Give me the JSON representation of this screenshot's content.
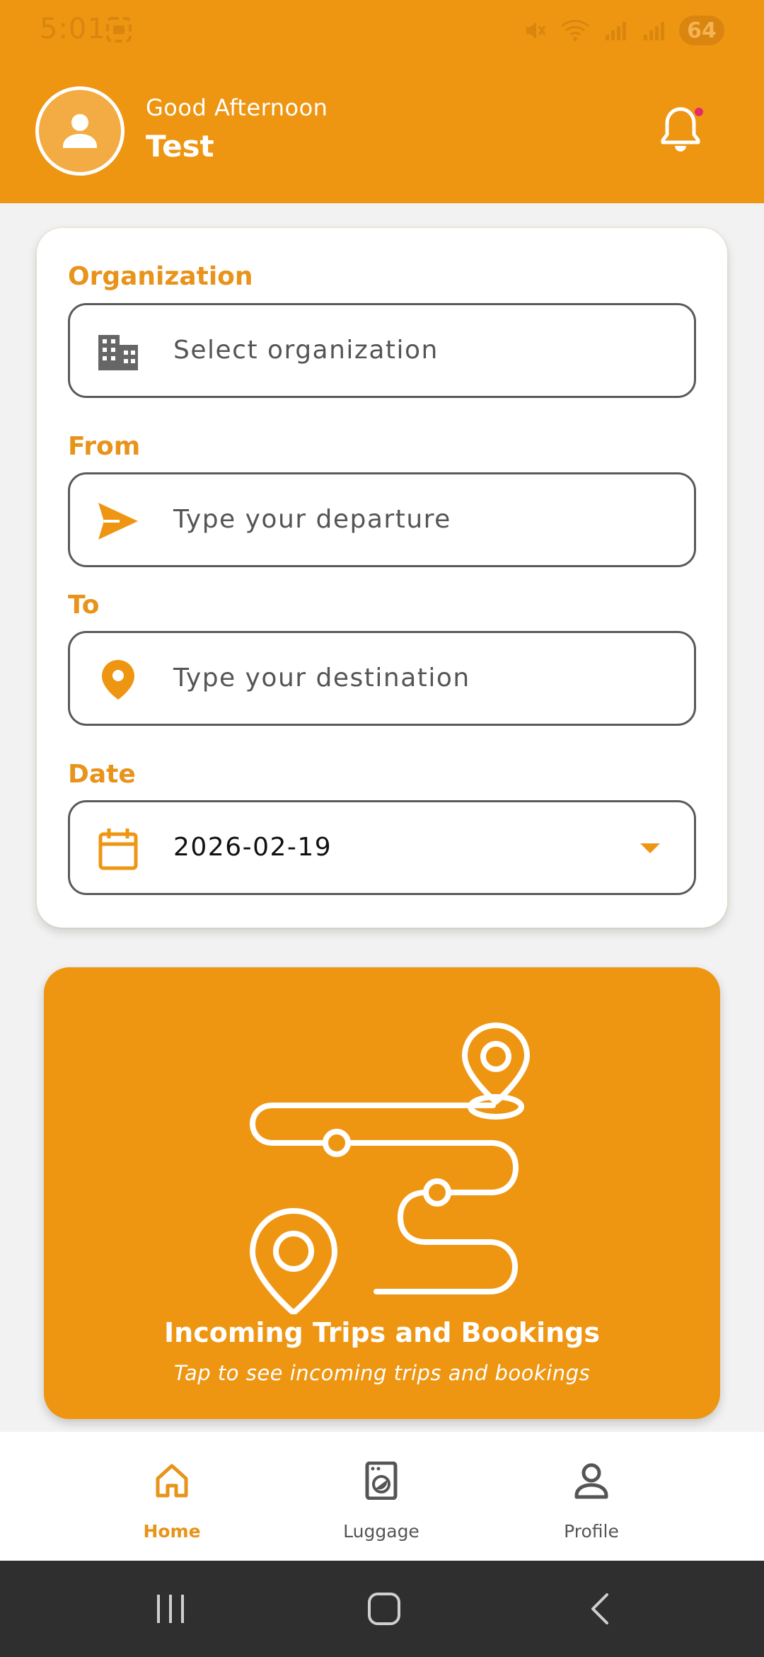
{
  "status_bar": {
    "time": "5:01",
    "battery": "64"
  },
  "header": {
    "greeting": "Good Afternoon",
    "username": "Test"
  },
  "form": {
    "organization": {
      "label": "Organization",
      "placeholder": "Select organization",
      "icon": "building-icon"
    },
    "from": {
      "label": "From",
      "placeholder": "Type your departure",
      "icon": "send-icon"
    },
    "to": {
      "label": "To",
      "placeholder": "Type your destination",
      "icon": "location-pin-icon"
    },
    "date": {
      "label": "Date",
      "value": "2026-02-19",
      "icon": "calendar-icon"
    }
  },
  "trips_card": {
    "title": "Incoming Trips and Bookings",
    "subtitle": "Tap to see incoming trips and bookings"
  },
  "bottom_nav": {
    "items": [
      {
        "label": "Home",
        "icon": "home-icon",
        "active": true
      },
      {
        "label": "Luggage",
        "icon": "luggage-icon",
        "active": false
      },
      {
        "label": "Profile",
        "icon": "profile-icon",
        "active": false
      }
    ]
  },
  "colors": {
    "primary": "#ee9612",
    "label": "#e8931a",
    "notification_dot": "#e62b6b",
    "system_nav": "#2f2f2f"
  }
}
